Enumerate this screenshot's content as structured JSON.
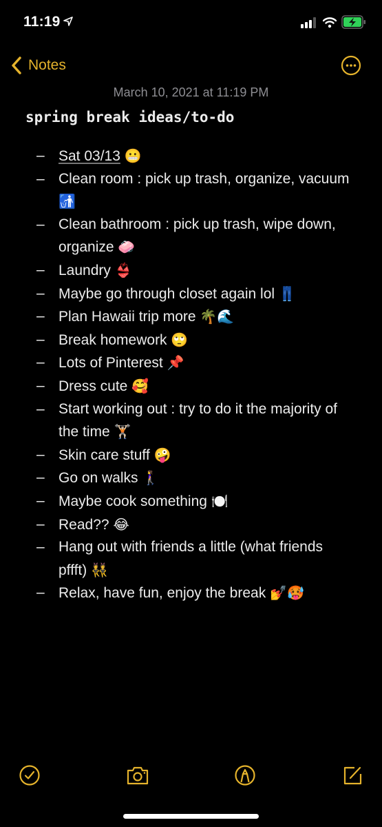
{
  "status_bar": {
    "time": "11:19",
    "location_icon": "location-arrow-icon",
    "signal_icon": "cellular-signal-icon",
    "wifi_icon": "wifi-icon",
    "battery_icon": "battery-charging-icon",
    "battery_color": "#30d158"
  },
  "nav": {
    "back_label": "Notes",
    "back_icon": "chevron-left-icon",
    "more_icon": "ellipsis-circle-icon",
    "accent_color": "#e5b32c"
  },
  "note": {
    "date": "March 10, 2021 at 11:19 PM",
    "title": "spring break ideas/to-do",
    "bullet": "–",
    "items": [
      {
        "text": "Sat 03/13",
        "emoji": "😬",
        "underlined": true
      },
      {
        "text": "Clean room : pick up trash, organize, vacuum",
        "emoji": "🚮"
      },
      {
        "text": "Clean bathroom : pick up trash, wipe down, organize",
        "emoji": "🧼"
      },
      {
        "text": "Laundry",
        "emoji": "👙"
      },
      {
        "text": "Maybe go through closet again lol",
        "emoji": "👖"
      },
      {
        "text": "Plan Hawaii trip more",
        "emoji": "🌴🌊"
      },
      {
        "text": "Break homework",
        "emoji": "🙄"
      },
      {
        "text": "Lots of Pinterest",
        "emoji": "📌"
      },
      {
        "text": "Dress cute",
        "emoji": "🥰"
      },
      {
        "text": "Start working out : try to do it the majority of the time",
        "emoji": "🏋🏻"
      },
      {
        "text": "Skin care stuff",
        "emoji": "🤪"
      },
      {
        "text": "Go on walks",
        "emoji": "🚶‍♀️"
      },
      {
        "text": "Maybe cook something",
        "emoji": "🍽️"
      },
      {
        "text": "Read??",
        "emoji": "😂"
      },
      {
        "text": "Hang out with friends a little (what friends pffft)",
        "emoji": "👯"
      },
      {
        "text": "Relax, have fun, enjoy the break",
        "emoji": "💅🥵"
      }
    ]
  },
  "toolbar": {
    "checklist_icon": "checklist-circle-icon",
    "camera_icon": "camera-icon",
    "markup_icon": "markup-pen-circle-icon",
    "compose_icon": "compose-icon"
  }
}
